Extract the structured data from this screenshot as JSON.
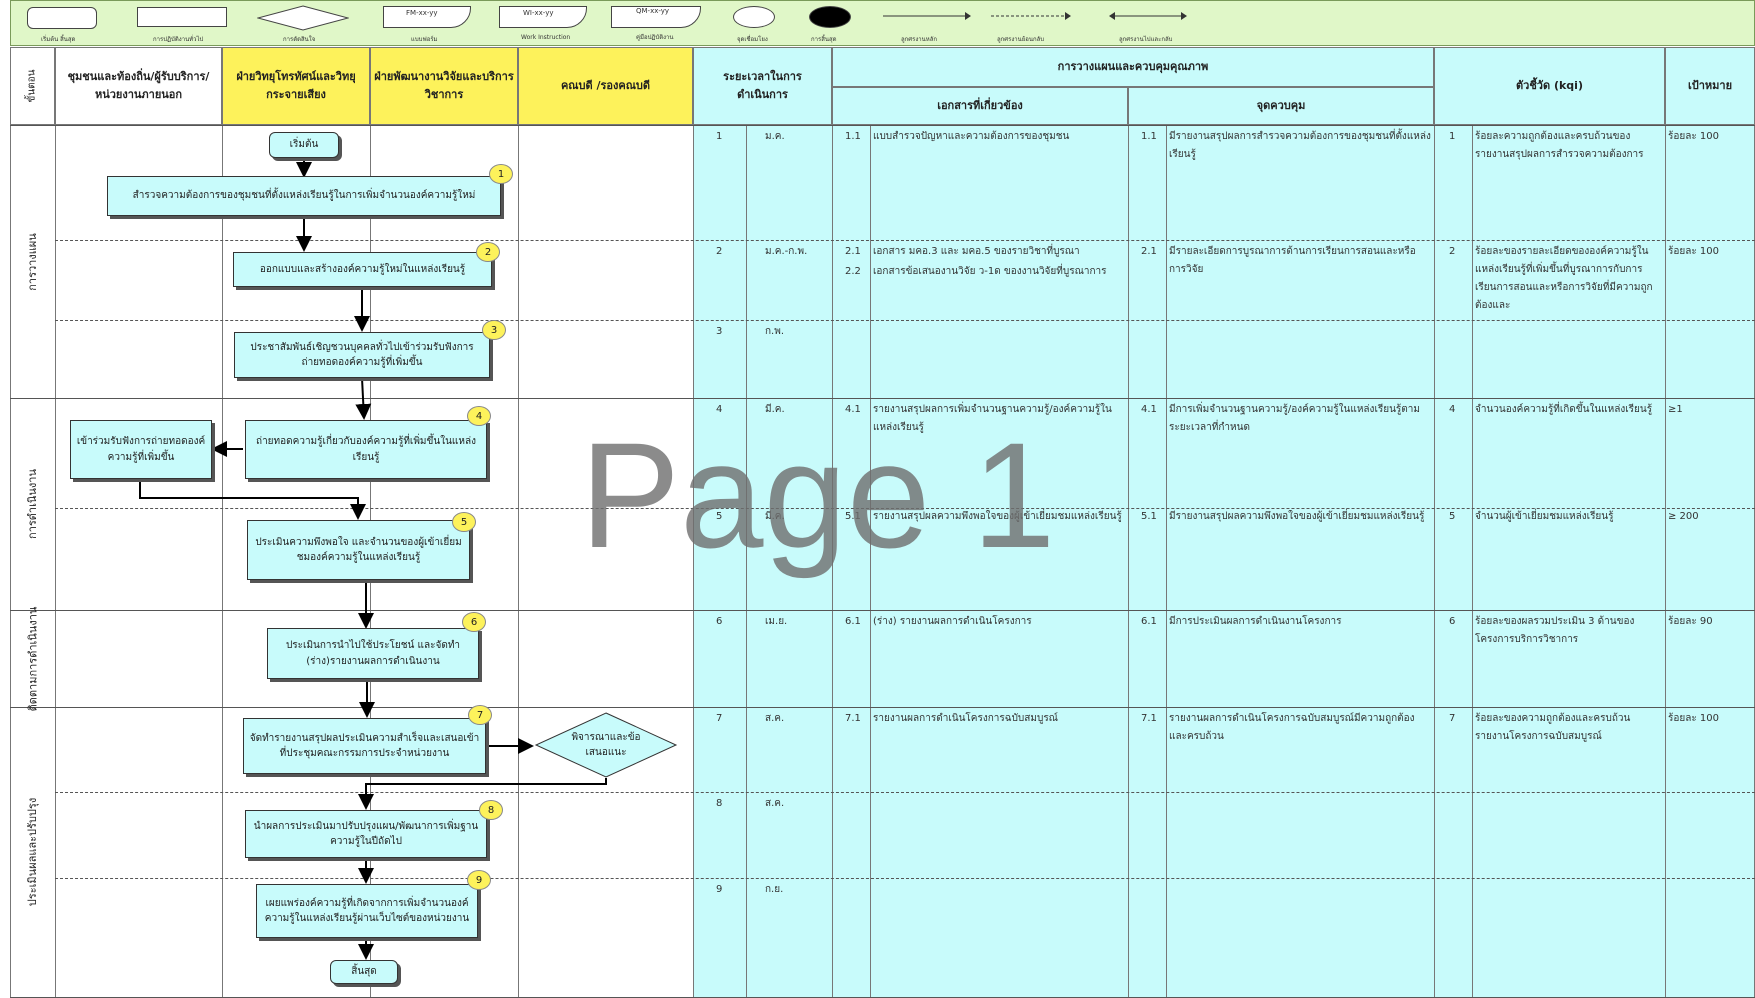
{
  "legend": [
    {
      "code": "",
      "label": "เริ่มต้น สิ้นสุด"
    },
    {
      "code": "",
      "label": "การปฏิบัติงานทั่วไป"
    },
    {
      "code": "",
      "label": "การตัดสินใจ"
    },
    {
      "code": "FM-xx-yy",
      "label": "แบบฟอร์ม"
    },
    {
      "code": "WI-xx-yy",
      "label": "Work Instruction"
    },
    {
      "code": "QM-xx-yy",
      "label": "คู่มือปฏิบัติงาน"
    },
    {
      "code": "",
      "label": "จุดเชื่อมโยง"
    },
    {
      "code": "",
      "label": "การสิ้นสุด"
    },
    {
      "code": "",
      "label": "ลูกศรงานหลัก"
    },
    {
      "code": "",
      "label": "ลูกศรงานย้อนกลับ"
    },
    {
      "code": "",
      "label": "ลูกศรงานไปและกลับ"
    }
  ],
  "headers": {
    "step": "ขั้นตอน",
    "community": "ชุมชนและท้องถิ่น/ผู้รับบริการ/หน่วยงานภายนอก",
    "radio": "ฝ่ายวิทยุโทรทัศน์และวิทยุกระจายเสียง",
    "research": "ฝ่ายพัฒนางานวิจัยและบริการวิชาการ",
    "dean": "คณบดี /รองคณบดี",
    "duration": "ระยะเวลาในการดำเนินการ",
    "qc": "การวางแผนและควบคุมคุณภาพ",
    "docs": "เอกสารที่เกี่ยวข้อง",
    "control": "จุดควบคุม",
    "kqi": "ตัวชี้วัด (kqi)",
    "target": "เป้าหมาย"
  },
  "phases": [
    "การวางแผน",
    "การดำเนินงาน",
    "ติดตามการดำเนินงาน",
    "ประเมินผลและปรับปรุง"
  ],
  "flow": {
    "start": "เริ่มต้น",
    "end": "สิ้นสุด",
    "external": "เข้าร่วมรับฟังการถ่ายทอดองค์ความรู้ที่เพิ่มขึ้น",
    "decision": "พิจารณาและข้อเสนอแนะ",
    "steps": [
      {
        "n": "1",
        "text": "สำรวจความต้องการของชุมชนที่ตั้งแหล่งเรียนรู้ในการเพิ่มจำนวนองค์ความรู้ใหม่"
      },
      {
        "n": "2",
        "text": "ออกแบบและสร้างองค์ความรู้ใหม่ในแหล่งเรียนรู้"
      },
      {
        "n": "3",
        "text": "ประชาสัมพันธ์เชิญชวนบุคคลทั่วไปเข้าร่วมรับฟังการถ่ายทอดองค์ความรู้ที่เพิ่มขึ้น"
      },
      {
        "n": "4",
        "text": "ถ่ายทอดความรู้เกี่ยวกับองค์ความรู้ที่เพิ่มขึ้นในแหล่งเรียนรู้"
      },
      {
        "n": "5",
        "text": "ประเมินความพึงพอใจ และจำนวนของผู้เข้าเยี่ยมชมองค์ความรู้ในแหล่งเรียนรู้"
      },
      {
        "n": "6",
        "text": "ประเมินการนำไปใช้ประโยชน์ และจัดทำ (ร่าง)รายงานผลการดำเนินงาน"
      },
      {
        "n": "7",
        "text": "จัดทำรายงานสรุปผลประเมินความสำเร็จและเสนอเข้าที่ประชุมคณะกรรมการประจำหน่วยงาน"
      },
      {
        "n": "8",
        "text": "นำผลการประเมินมาปรับปรุงแผน/พัฒนาการเพิ่มฐานความรู้ในปีถัดไป"
      },
      {
        "n": "9",
        "text": "เผยแพร่องค์ความรู้ที่เกิดจากการเพิ่มจำนวนองค์ความรู้ในแหล่งเรียนรู้ผ่านเว็บไซต์ของหน่วยงาน"
      }
    ]
  },
  "rows": [
    {
      "n": "1",
      "time": "ม.ค.",
      "docs": [
        {
          "id": "1.1",
          "text": "แบบสำรวจปัญหาและความต้องการของชุมชน"
        }
      ],
      "ctrl_id": "1.1",
      "ctrl": "มีรายงานสรุปผลการสำรวจความต้องการของชุมชนที่ตั้งแหล่งเรียนรู้",
      "kqi_n": "1",
      "kqi": "ร้อยละความถูกต้องและครบถ้วนของรายงานสรุปผลการสำรวจความต้องการ",
      "target": "ร้อยละ 100"
    },
    {
      "n": "2",
      "time": "ม.ค.-ก.พ.",
      "docs": [
        {
          "id": "2.1",
          "text": "เอกสาร มคอ.3 และ มคอ.5 ของรายวิชาที่บูรณา"
        },
        {
          "id": "2.2",
          "text": "เอกสารข้อเสนองานวิจัย ว-1ด ของงานวิจัยที่บูรณาการ"
        }
      ],
      "ctrl_id": "2.1",
      "ctrl": "มีรายละเอียดการบูรณาการด้านการเรียนการสอนและหรือการวิจัย",
      "kqi_n": "2",
      "kqi": "ร้อยละของรายละเอียดขององค์ความรู้ในแหล่งเรียนรู้ที่เพิ่มขึ้นที่บูรณาการกับการเรียนการสอนและหรือการวิจัยที่มีความถูกต้องและ",
      "target": "ร้อยละ 100"
    },
    {
      "n": "3",
      "time": "ก.พ.",
      "docs": [],
      "ctrl_id": "",
      "ctrl": "",
      "kqi_n": "",
      "kqi": "",
      "target": ""
    },
    {
      "n": "4",
      "time": "มี.ค.",
      "docs": [
        {
          "id": "4.1",
          "text": "รายงานสรุปผลการเพิ่มจำนวนฐานความรู้/องค์ความรู้ในแหล่งเรียนรู้"
        }
      ],
      "ctrl_id": "4.1",
      "ctrl": "มีการเพิ่มจำนวนฐานความรู้/องค์ความรู้ในแหล่งเรียนรู้ตามระยะเวลาที่กำหนด",
      "kqi_n": "4",
      "kqi": "จำนวนองค์ความรู้ที่เกิดขึ้นในแหล่งเรียนรู้",
      "target": "≥1"
    },
    {
      "n": "5",
      "time": "มี.ค.",
      "docs": [
        {
          "id": "5.1",
          "text": "รายงานสรุปผลความพึงพอใจของผู้เข้าเยี่ยมชมแหล่งเรียนรู้"
        }
      ],
      "ctrl_id": "5.1",
      "ctrl": "มีรายงานสรุปผลความพึงพอใจของผู้เข้าเยี่ยมชมแหล่งเรียนรู้",
      "kqi_n": "5",
      "kqi": "จำนวนผู้เข้าเยี่ยมชมแหล่งเรียนรู้",
      "target": "≥ 200"
    },
    {
      "n": "6",
      "time": "เม.ย.",
      "docs": [
        {
          "id": "6.1",
          "text": "(ร่าง) รายงานผลการดำเนินโครงการ"
        }
      ],
      "ctrl_id": "6.1",
      "ctrl": "มีการประเมินผลการดำเนินงานโครงการ",
      "kqi_n": "6",
      "kqi": "ร้อยละของผลรวมประเมิน 3 ด้านของโครงการบริการวิชาการ",
      "target": "ร้อยละ 90"
    },
    {
      "n": "7",
      "time": "ส.ค.",
      "docs": [
        {
          "id": "7.1",
          "text": "รายงานผลการดำเนินโครงการฉบับสมบูรณ์"
        }
      ],
      "ctrl_id": "7.1",
      "ctrl": "รายงานผลการดำเนินโครงการฉบับสมบูรณ์มีความถูกต้องและครบถ้วน",
      "kqi_n": "7",
      "kqi": "ร้อยละของความถูกต้องและครบถ้วนรายงานโครงการฉบับสมบูรณ์",
      "target": "ร้อยละ 100"
    },
    {
      "n": "8",
      "time": "ส.ค.",
      "docs": [],
      "ctrl_id": "",
      "ctrl": "",
      "kqi_n": "",
      "kqi": "",
      "target": ""
    },
    {
      "n": "9",
      "time": "ก.ย.",
      "docs": [],
      "ctrl_id": "",
      "ctrl": "",
      "kqi_n": "",
      "kqi": "",
      "target": ""
    }
  ],
  "watermark": "Page 1"
}
